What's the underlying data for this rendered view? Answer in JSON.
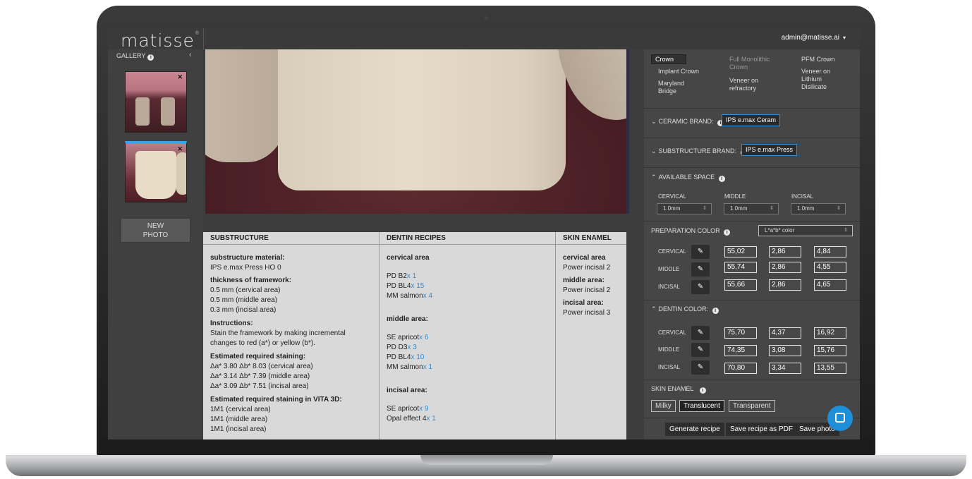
{
  "app": {
    "logo": "matisse",
    "logo_mark": "®"
  },
  "user": {
    "email": "admin@matisse.ai",
    "caret": "▾"
  },
  "gallery": {
    "title": "GALLERY",
    "info": "i",
    "collapse": "‹",
    "thumb_close": "✕",
    "new_photo_line1": "NEW",
    "new_photo_line2": "PHOTO"
  },
  "recipes": {
    "substructure": {
      "header": "SUBSTRUCTURE",
      "material_label": "substructure material:",
      "material_value": "IPS e.max Press HO 0",
      "thickness_label": "thickness of framework:",
      "thickness": [
        "0.5 mm (cervical area)",
        "0.5 mm (middle area)",
        "0.3 mm (incisal area)"
      ],
      "instructions_label": "Instructions:",
      "instructions_l1": "Stain the framework by making incremental",
      "instructions_l2": "changes to red (a*) or yellow (b*).",
      "staining_label": "Estimated required staining:",
      "staining": [
        "Δa* 3.80 Δb* 8.03 (cervical area)",
        "Δa* 3.14 Δb* 7.39 (middle area)",
        "Δa* 3.09 Δb* 7.51 (incisal area)"
      ],
      "vita_label": "Estimated required staining in VITA 3D:",
      "vita": [
        "1M1 (cervical area)",
        "1M1 (middle area)",
        "1M1 (incisal area)"
      ]
    },
    "dentin": {
      "header": "DENTIN RECIPES",
      "cervical_label": "cervical area",
      "cervical": [
        {
          "name": "PD B2",
          "qty": "x 1"
        },
        {
          "name": "PD BL4",
          "qty": "x 15"
        },
        {
          "name": "MM salmon",
          "qty": "x 4"
        }
      ],
      "middle_label": "middle area:",
      "middle": [
        {
          "name": "SE apricot",
          "qty": "x 6"
        },
        {
          "name": "PD D3",
          "qty": "x 3"
        },
        {
          "name": "PD BL4",
          "qty": "x 10"
        },
        {
          "name": "MM salmon",
          "qty": "x 1"
        }
      ],
      "incisal_label": "incisal area:",
      "incisal": [
        {
          "name": "SE apricot",
          "qty": "x 9"
        },
        {
          "name": "Opal effect 4",
          "qty": "x 1"
        }
      ]
    },
    "skin_enamel": {
      "header": "SKIN ENAMEL",
      "cervical_label": "cervical area",
      "cervical_value": "Power incisal 2",
      "middle_label": "middle area:",
      "middle_value": "Power incisal 2",
      "incisal_label": "incisal area:",
      "incisal_value": "Power incisal 3"
    }
  },
  "panel": {
    "restoration_types": {
      "crown": "Crown",
      "implant_crown": "Implant Crown",
      "maryland_l1": "Maryland",
      "maryland_l2": "Bridge",
      "full_mono_l1": "Full Monolithic",
      "full_mono_l2": "Crown",
      "veneer_refr_l1": "Veneer on",
      "veneer_refr_l2": "refractory",
      "pfm": "PFM Crown",
      "veneer_lith_l1": "Veneer on",
      "veneer_lith_l2": "Lithium",
      "veneer_lith_l3": "Disilicate"
    },
    "ceramic_brand": {
      "label": "CERAMIC BRAND:",
      "value": "IPS e.max Ceram"
    },
    "substructure_brand": {
      "label": "SUBSTRUCTURE BRAND:",
      "value": "IPS e.max Press"
    },
    "available_space": {
      "label": "AVAILABLE SPACE",
      "cervical": "CERVICAL",
      "middle": "MIDDLE",
      "incisal": "INCISAL",
      "cervical_val": "1.0mm",
      "middle_val": "1.0mm",
      "incisal_val": "1.0mm"
    },
    "preparation_color": {
      "label": "PREPARATION COLOR",
      "mode": "L*a*b* color",
      "rows": [
        {
          "name": "CERVICAL",
          "l": "55,02",
          "a": "2,86",
          "b": "4,84"
        },
        {
          "name": "MIDDLE",
          "l": "55,74",
          "a": "2,86",
          "b": "4,55"
        },
        {
          "name": "INCISAL",
          "l": "55,66",
          "a": "2,86",
          "b": "4,65"
        }
      ]
    },
    "dentin_color": {
      "label": "DENTIN COLOR:",
      "rows": [
        {
          "name": "CERVICAL",
          "l": "75,70",
          "a": "4,37",
          "b": "16,92"
        },
        {
          "name": "MIDDLE",
          "l": "74,35",
          "a": "3,08",
          "b": "15,76"
        },
        {
          "name": "INCISAL",
          "l": "70,80",
          "a": "3,34",
          "b": "13,55"
        }
      ]
    },
    "skin_enamel": {
      "label": "SKIN ENAMEL",
      "options": [
        "Milky",
        "Translucent",
        "Transparent"
      ],
      "selected": "Translucent"
    },
    "actions": {
      "generate": "Generate recipe",
      "save_pdf": "Save recipe as PDF",
      "save_photo": "Save photo"
    },
    "icons": {
      "chevron_down": "⌄",
      "chevron_up": "⌃",
      "eyedropper": "✎",
      "select_arrows": "⇕"
    }
  },
  "colors": {
    "accent": "#3aa5e6",
    "link_blue": "#2f8fd3",
    "chat": "#1f8ed9"
  }
}
